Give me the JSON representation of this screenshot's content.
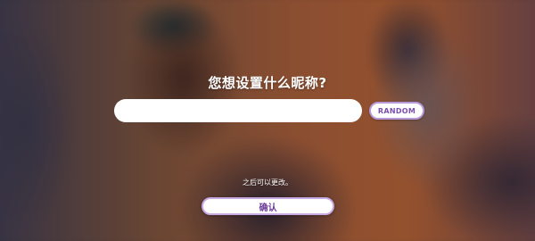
{
  "dialog": {
    "title": "您想设置什么昵称?",
    "name_input": {
      "value": "",
      "placeholder": ""
    },
    "random_label": "RANDOM",
    "hint": "之后可以更改。",
    "confirm_label": "确认"
  },
  "colors": {
    "accent_border": "#b99ad8",
    "accent_text": "#7a4fae",
    "button_bg": "#ffffff"
  }
}
